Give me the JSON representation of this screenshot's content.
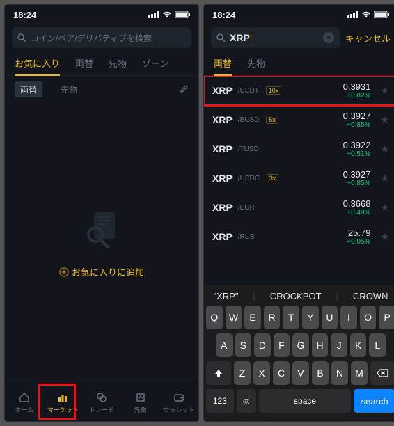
{
  "status": {
    "time": "18:24"
  },
  "left": {
    "search_placeholder": "コイン/ペア/デリバティブを検索",
    "tabs": [
      "お気に入り",
      "両替",
      "先物",
      "ゾーン"
    ],
    "active_tab": 0,
    "subtabs": [
      "両替",
      "先物"
    ],
    "active_subtab": 0,
    "add_fav": "お気に入りに追加",
    "bottom_nav": [
      {
        "label": "ホーム"
      },
      {
        "label": "マーケット"
      },
      {
        "label": "トレード"
      },
      {
        "label": "先物"
      },
      {
        "label": "ウォレット"
      }
    ],
    "active_bottom": 1
  },
  "right": {
    "search_value": "XRP",
    "cancel": "キャンセル",
    "tabs": [
      "両替",
      "先物"
    ],
    "active_tab": 0,
    "results": [
      {
        "sym": "XRP",
        "pair": "/USDT",
        "lev": "10x",
        "price": "0.3931",
        "chg": "+0.82%",
        "hl": true
      },
      {
        "sym": "XRP",
        "pair": "/BUSD",
        "lev": "5x",
        "price": "0.3927",
        "chg": "+0.85%"
      },
      {
        "sym": "XRP",
        "pair": "/TUSD",
        "lev": "",
        "price": "0.3922",
        "chg": "+0.51%"
      },
      {
        "sym": "XRP",
        "pair": "/USDC",
        "lev": "3x",
        "price": "0.3927",
        "chg": "+0.85%"
      },
      {
        "sym": "XRP",
        "pair": "/EUR",
        "lev": "",
        "price": "0.3668",
        "chg": "+0.49%"
      },
      {
        "sym": "XRP",
        "pair": "/RUB",
        "lev": "",
        "price": "25.79",
        "chg": "+9.05%"
      }
    ],
    "suggestions": [
      "\"XRP\"",
      "CROCKPOT",
      "CROWN"
    ],
    "keyboard": {
      "r1": [
        "Q",
        "W",
        "E",
        "R",
        "T",
        "Y",
        "U",
        "I",
        "O",
        "P"
      ],
      "r2": [
        "A",
        "S",
        "D",
        "F",
        "G",
        "H",
        "J",
        "K",
        "L"
      ],
      "r3": [
        "Z",
        "X",
        "C",
        "V",
        "B",
        "N",
        "M"
      ],
      "num": "123",
      "space": "space",
      "search": "search"
    }
  }
}
